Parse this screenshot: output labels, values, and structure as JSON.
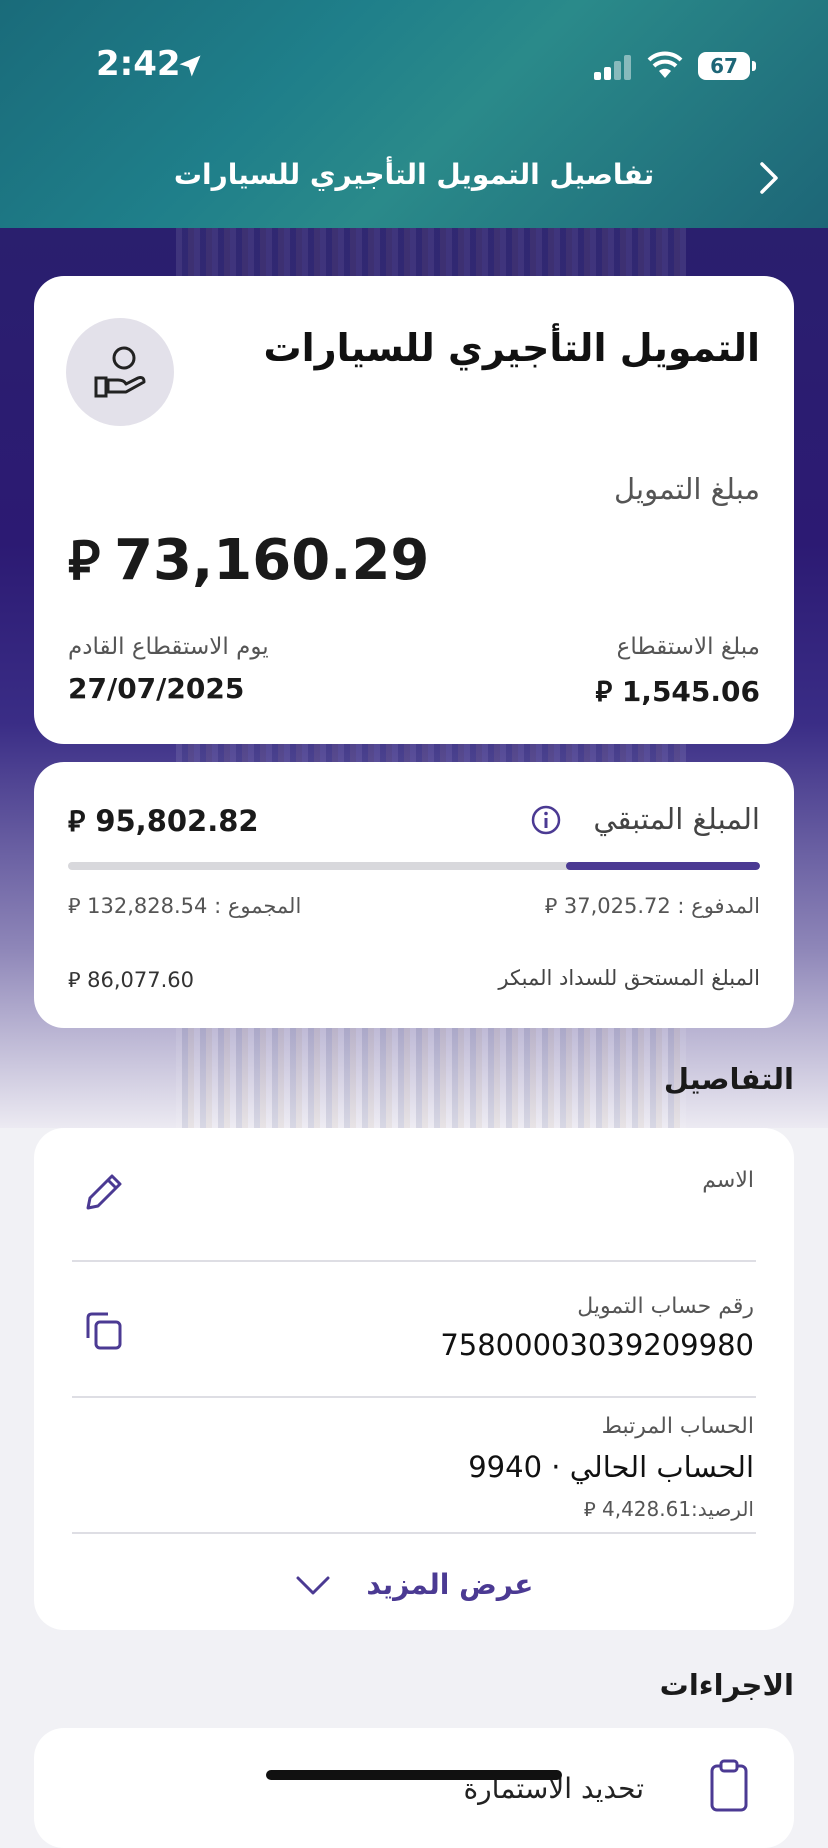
{
  "status_bar": {
    "time": "2:42",
    "battery": "67"
  },
  "header": {
    "title": "تفاصيل التمويل التأجيري للسيارات"
  },
  "summary": {
    "product_title": "التمويل التأجيري للسيارات",
    "amount_label": "مبلغ التمويل",
    "amount_value": "73,160.29",
    "currency_symbol": "⃁",
    "deduction_label": "مبلغ الاستقطاع",
    "deduction_value": "1,545.06",
    "next_deduction_label": "يوم الاستقطاع القادم",
    "next_deduction_date": "27/07/2025"
  },
  "remaining": {
    "label": "المبلغ المتبقي",
    "value": "95,802.82",
    "progress_fraction": 0.28,
    "paid_text": "المدفوع : 37,025.72",
    "total_text": "المجموع : 132,828.54",
    "early_payoff_label": "المبلغ المستحق للسداد المبكر",
    "early_payoff_value": "86,077.60"
  },
  "details": {
    "section_title": "التفاصيل",
    "name_label": "الاسم",
    "account_label": "رقم حساب التمويل",
    "account_number": "7580000303920998​0",
    "linked_label": "الحساب المرتبط",
    "linked_value": "الحساب الحالي · 9940",
    "balance_text": "الرصيد:4,428.61",
    "show_more": "عرض المزيد"
  },
  "actions": {
    "section_title": "الاجراءات",
    "item_label": "تحديد الاستمارة"
  },
  "colors": {
    "accent": "#4b3a93",
    "header_teal": "#1d6677",
    "deep_purple": "#2c1a73"
  }
}
